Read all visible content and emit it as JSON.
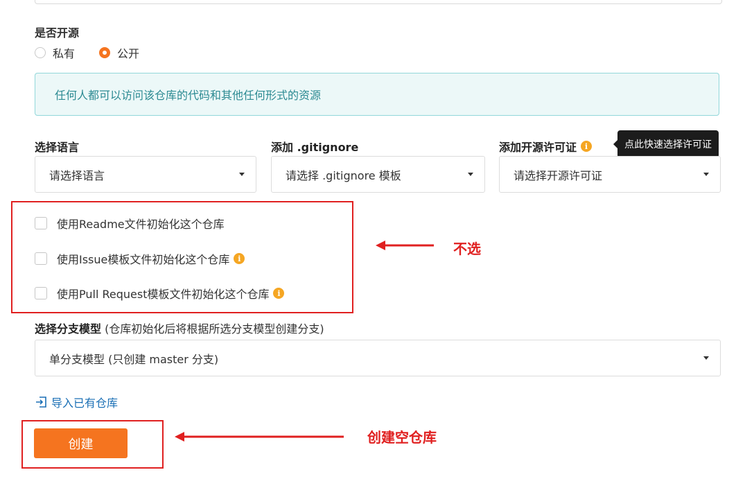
{
  "open_source": {
    "title": "是否开源",
    "options": [
      {
        "label": "私有",
        "selected": false
      },
      {
        "label": "公开",
        "selected": true
      }
    ],
    "info": "任何人都可以访问该仓库的代码和其他任何形式的资源"
  },
  "language": {
    "label": "选择语言",
    "placeholder": "请选择语言"
  },
  "gitignore": {
    "label": "添加 .gitignore",
    "placeholder": "请选择 .gitignore 模板"
  },
  "license": {
    "label": "添加开源许可证",
    "placeholder": "请选择开源许可证",
    "tooltip": "点此快速选择许可证"
  },
  "init_options": [
    {
      "label": "使用Readme文件初始化这个仓库",
      "info": false
    },
    {
      "label": "使用Issue模板文件初始化这个仓库",
      "info": true
    },
    {
      "label": "使用Pull Request模板文件初始化这个仓库",
      "info": true
    }
  ],
  "branch": {
    "label": "选择分支模型",
    "hint": "(仓库初始化后将根据所选分支模型创建分支)",
    "value": "单分支模型 (只创建 master 分支)"
  },
  "import_link": "导入已有仓库",
  "create_button": "创建",
  "annotations": {
    "no_select": "不选",
    "create_empty": "创建空仓库"
  },
  "colors": {
    "accent": "#f5741f",
    "annotation": "#e02020",
    "info_text": "#2c8a92",
    "link": "#1a6fb5"
  },
  "icons": [
    "info-icon",
    "import-icon",
    "caret-down-icon",
    "arrow-left-icon"
  ]
}
